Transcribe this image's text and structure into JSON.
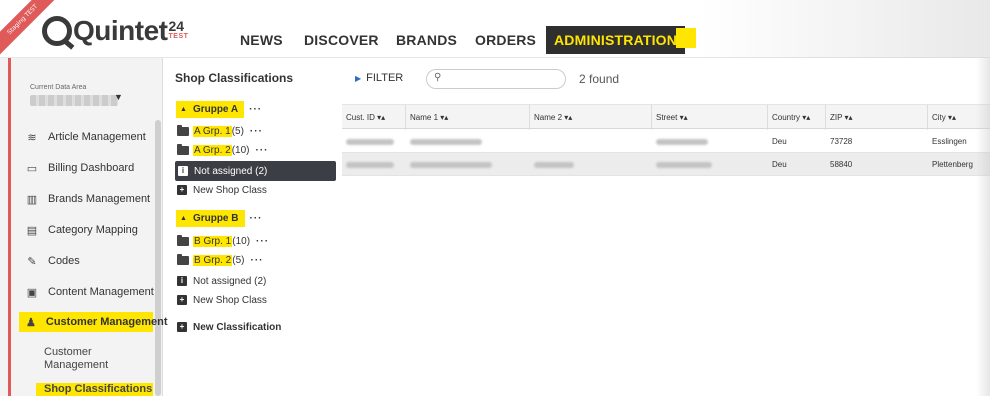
{
  "ribbon": "Staging TEST",
  "logo": {
    "text": "Quintet",
    "number": "24",
    "badge": "TEST"
  },
  "nav": [
    "NEWS",
    "DISCOVER",
    "BRANDS",
    "ORDERS",
    "ADMINISTRATION"
  ],
  "data_area": {
    "label": "Current Data Area"
  },
  "sidebar": {
    "items": [
      {
        "label": "Article Management",
        "icon": "database-icon"
      },
      {
        "label": "Billing Dashboard",
        "icon": "card-icon"
      },
      {
        "label": "Brands Management",
        "icon": "building-icon"
      },
      {
        "label": "Category Mapping",
        "icon": "clipboard-icon"
      },
      {
        "label": "Codes",
        "icon": "edit-icon"
      },
      {
        "label": "Content Management",
        "icon": "monitor-icon"
      },
      {
        "label": "Customer Management",
        "icon": "users-icon"
      }
    ],
    "subitems": [
      "Customer Management",
      "Shop Classifications"
    ]
  },
  "tree": {
    "title": "Shop Classifications",
    "groups": [
      {
        "name": "Gruppe A",
        "items": [
          {
            "name": "A Grp. 1",
            "count": "(5)"
          },
          {
            "name": "A Grp. 2",
            "count": "(10)"
          }
        ],
        "not_assigned": "Not assigned (2)",
        "new_label": "New Shop Class"
      },
      {
        "name": "Gruppe B",
        "items": [
          {
            "name": "B Grp. 1",
            "count": "(10)"
          },
          {
            "name": "B Grp. 2",
            "count": "(5)"
          }
        ],
        "not_assigned": "Not assigned (2)",
        "new_label": "New Shop Class"
      }
    ],
    "new_classification": "New Classification",
    "dots": "···"
  },
  "toolbar": {
    "filter": "FILTER",
    "search_placeholder": "",
    "found": "2 found"
  },
  "grid": {
    "columns": [
      "Cust. ID ▾▴",
      "Name 1 ▾▴",
      "Name 2 ▾▴",
      "Street ▾▴",
      "Country ▾▴",
      "ZIP ▾▴",
      "City ▾▴"
    ],
    "rows": [
      {
        "country": "Deu",
        "zip": "73728",
        "city": "Esslingen"
      },
      {
        "country": "Deu",
        "zip": "58840",
        "city": "Plettenberg"
      }
    ]
  },
  "colors": {
    "highlight": "#ffe600",
    "active_nav_bg": "#2f2f2f",
    "selected_bg": "#3b3f45",
    "accent": "#e05a5a"
  }
}
